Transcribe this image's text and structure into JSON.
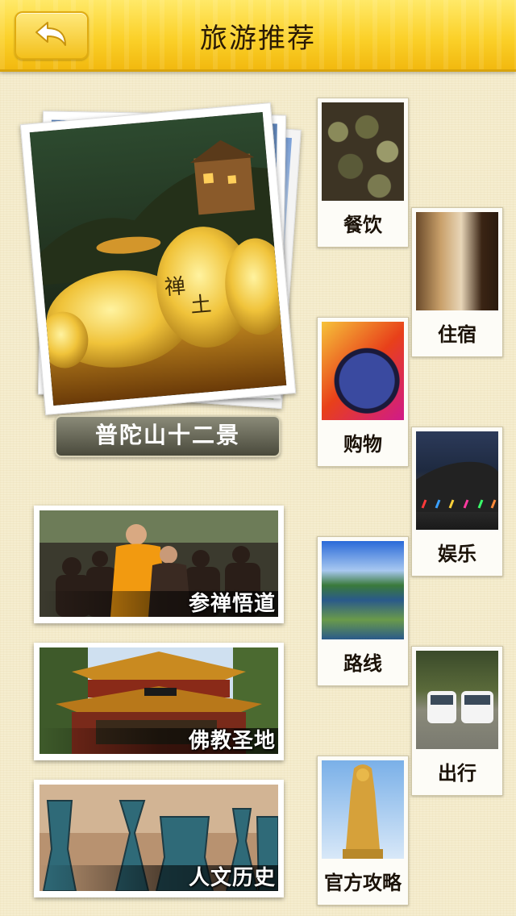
{
  "header": {
    "title": "旅游推荐",
    "back_icon": "back-arrow-icon"
  },
  "featured": {
    "button_label": "普陀山十二景"
  },
  "banners": [
    {
      "caption": "参禅悟道"
    },
    {
      "caption": "佛教圣地"
    },
    {
      "caption": "人文历史"
    }
  ],
  "categories": [
    {
      "label": "餐饮"
    },
    {
      "label": "住宿"
    },
    {
      "label": "购物"
    },
    {
      "label": "娱乐"
    },
    {
      "label": "路线"
    },
    {
      "label": "出行"
    },
    {
      "label": "官方攻略"
    }
  ],
  "colors": {
    "header": "#fbd12a",
    "background": "#f5edcf",
    "button": "#5a5a4a"
  }
}
